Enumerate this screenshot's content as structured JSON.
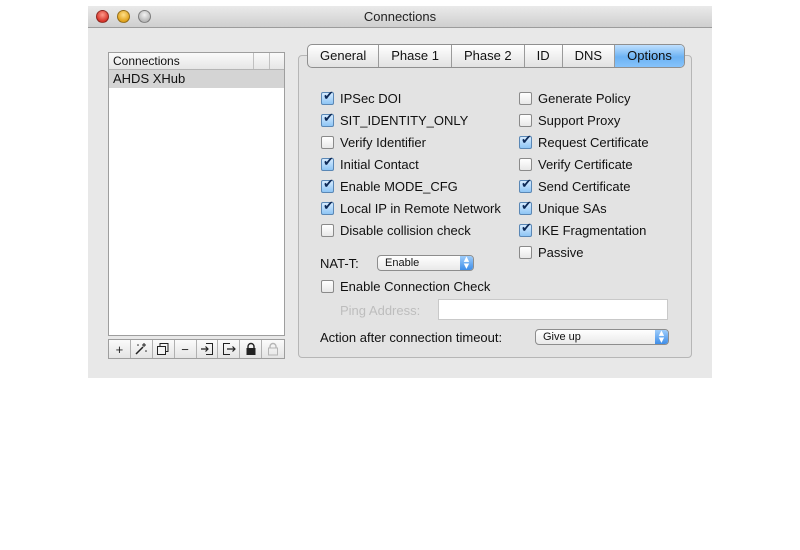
{
  "window": {
    "title": "Connections"
  },
  "sidebar": {
    "column_header": "Connections",
    "items": [
      {
        "label": "AHDS XHub",
        "selected": true
      }
    ],
    "toolbar": [
      {
        "icon": "plus-icon",
        "glyph": "+"
      },
      {
        "icon": "magic-wand-icon",
        "glyph": ""
      },
      {
        "icon": "duplicate-icon",
        "glyph": ""
      },
      {
        "icon": "minus-icon",
        "glyph": "−"
      },
      {
        "icon": "import-icon",
        "glyph": ""
      },
      {
        "icon": "export-icon",
        "glyph": ""
      },
      {
        "icon": "lock-icon",
        "glyph": ""
      },
      {
        "icon": "lock-disabled-icon",
        "glyph": ""
      }
    ]
  },
  "tabs": [
    {
      "label": "General",
      "active": false
    },
    {
      "label": "Phase 1",
      "active": false
    },
    {
      "label": "Phase 2",
      "active": false
    },
    {
      "label": "ID",
      "active": false
    },
    {
      "label": "DNS",
      "active": false
    },
    {
      "label": "Options",
      "active": true
    }
  ],
  "options": {
    "left": [
      {
        "label": "IPSec DOI",
        "checked": true
      },
      {
        "label": "SIT_IDENTITY_ONLY",
        "checked": true
      },
      {
        "label": "Verify Identifier",
        "checked": false
      },
      {
        "label": "Initial Contact",
        "checked": true
      },
      {
        "label": "Enable MODE_CFG",
        "checked": true
      },
      {
        "label": "Local IP in Remote Network",
        "checked": true
      },
      {
        "label": "Disable collision check",
        "checked": false
      }
    ],
    "right": [
      {
        "label": "Generate Policy",
        "checked": false
      },
      {
        "label": "Support Proxy",
        "checked": false
      },
      {
        "label": "Request Certificate",
        "checked": true
      },
      {
        "label": "Verify Certificate",
        "checked": false
      },
      {
        "label": "Send Certificate",
        "checked": true
      },
      {
        "label": "Unique SAs",
        "checked": true
      },
      {
        "label": "IKE Fragmentation",
        "checked": true
      },
      {
        "label": "Passive",
        "checked": false
      }
    ],
    "nat_t_label": "NAT-T:",
    "nat_t_value": "Enable",
    "connection_check": {
      "label": "Enable Connection Check",
      "checked": false
    },
    "ping_address_label": "Ping Address:",
    "ping_address_value": "",
    "timeout_label": "Action after connection timeout:",
    "timeout_value": "Give up"
  },
  "colors": {
    "accent": "#6cb2f3",
    "checkbox_on": "#8ec5f5"
  }
}
